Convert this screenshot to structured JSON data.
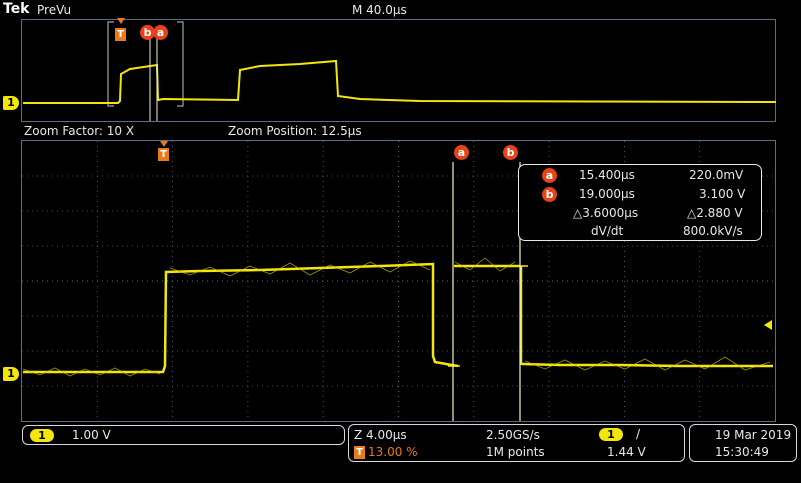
{
  "header": {
    "brand": "Tek",
    "mode": "PreVu",
    "timebase": "M 40.0μs"
  },
  "overview": {
    "trigger_marker": "T",
    "cursor_b_marker": "b",
    "cursor_a_marker": "a",
    "channel_marker": "1"
  },
  "zoom_info": {
    "factor": "Zoom Factor: 10 X",
    "position": "Zoom Position: 12.5μs"
  },
  "main": {
    "trigger_marker": "T",
    "cursor_a_marker": "a",
    "cursor_b_marker": "b",
    "channel_marker": "1"
  },
  "cursors": {
    "a_label": "a",
    "a_time": "15.400μs",
    "a_volt": "220.0mV",
    "b_label": "b",
    "b_time": "19.000μs",
    "b_volt": "3.100 V",
    "delta_time": "△3.6000μs",
    "delta_volt": "△2.880 V",
    "dvdt_label": "dV/dt",
    "dvdt_value": "800.0kV/s"
  },
  "status": {
    "ch1_badge": "1",
    "ch1_scale": "1.00 V",
    "zoom_scale": "Z 4.00μs",
    "sample_rate": "2.50GS/s",
    "trigger_icon": "T",
    "trigger_position": "13.00 %",
    "record_length": "1M points",
    "trigger_source": "1",
    "trigger_slope": "/",
    "trigger_level": "1.44 V",
    "date": "19 Mar  2019",
    "time": "15:30:49"
  },
  "colors": {
    "trace": "#f2e60a",
    "grid": "#56687f",
    "cursor": "#f3efc4",
    "badge": "#e8421a",
    "trigger": "#e87a1a"
  }
}
